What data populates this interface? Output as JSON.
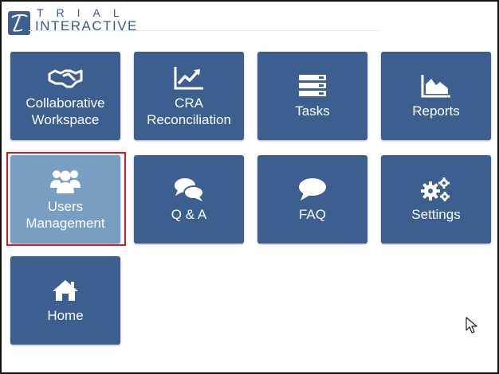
{
  "brand": {
    "line1": "TRIAL",
    "line2": "INTERACTIVE",
    "colors": {
      "primary": "#3c5f8f",
      "selected": "#7a9ec2",
      "highlight": "#e0161c"
    }
  },
  "tiles": [
    {
      "id": "collaborative-workspace",
      "label": "Collaborative\nWorkspace",
      "icon": "handshake-icon"
    },
    {
      "id": "cra-reconciliation",
      "label": "CRA\nReconciliation",
      "icon": "trend-chart-icon"
    },
    {
      "id": "tasks",
      "label": "Tasks",
      "icon": "tasks-list-icon"
    },
    {
      "id": "reports",
      "label": "Reports",
      "icon": "area-chart-icon"
    },
    {
      "id": "users-management",
      "label": "Users\nManagement",
      "icon": "users-icon",
      "selected": true
    },
    {
      "id": "qa",
      "label": "Q & A",
      "icon": "chat-bubbles-icon"
    },
    {
      "id": "faq",
      "label": "FAQ",
      "icon": "chat-bubble-icon"
    },
    {
      "id": "settings",
      "label": "Settings",
      "icon": "gears-icon"
    },
    {
      "id": "home",
      "label": "Home",
      "icon": "home-icon"
    }
  ]
}
